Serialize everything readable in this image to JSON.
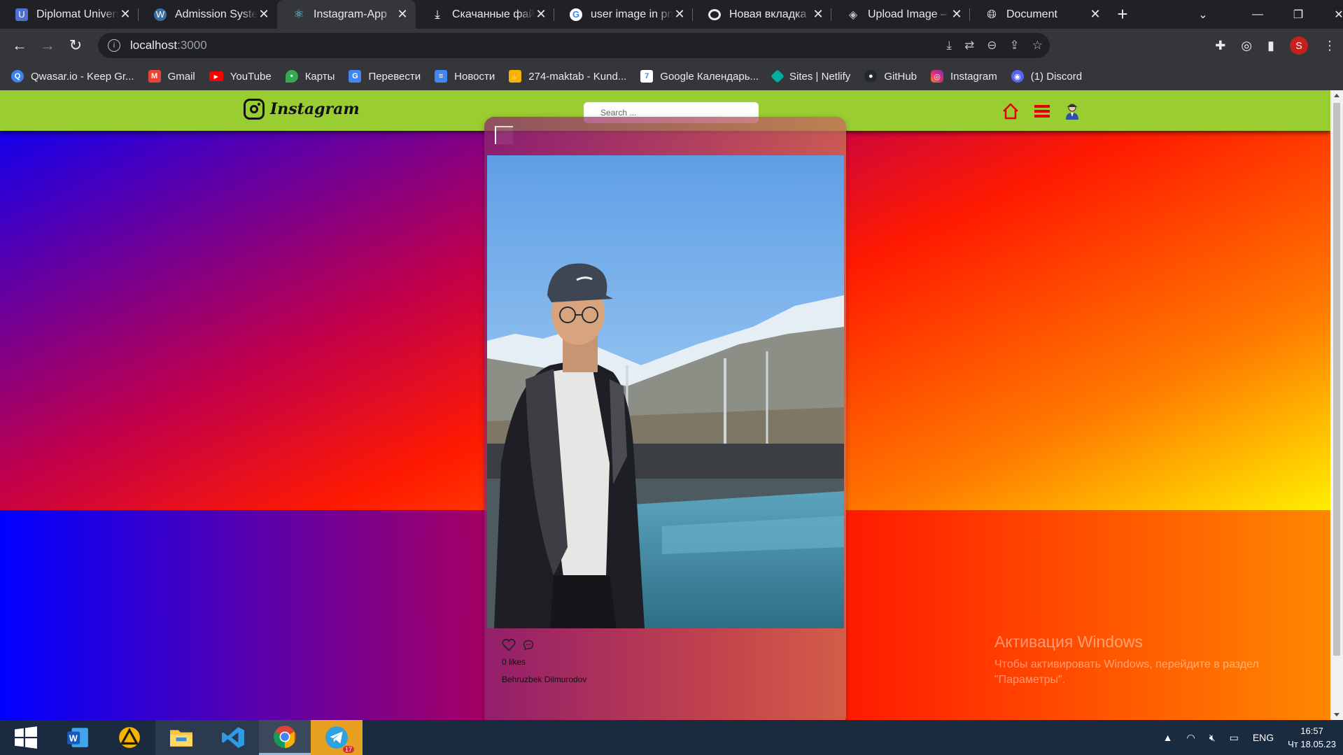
{
  "browser": {
    "tabs": [
      {
        "title": "Diplomat University",
        "favicon": "university-icon",
        "color": "#4f6fd6"
      },
      {
        "title": "Admission System",
        "favicon": "wordpress-icon",
        "color": "#3a6ea5"
      },
      {
        "title": "Instagram-App",
        "favicon": "react-icon",
        "color": "#61dafb",
        "active": true
      },
      {
        "title": "Скачанные файлы",
        "favicon": "download-icon",
        "color": "#e8eaed"
      },
      {
        "title": "user image in png",
        "favicon": "google-icon",
        "color": "#4285f4"
      },
      {
        "title": "Новая вкладка",
        "favicon": "chrome-icon",
        "color": "#e8eaed"
      },
      {
        "title": "Upload Image – n",
        "favicon": "layers-icon",
        "color": "#bdc1c6"
      },
      {
        "title": "Document",
        "favicon": "globe-icon",
        "color": "#e8eaed"
      }
    ],
    "url_host": "localhost",
    "url_port": ":3000",
    "profile_initial": "S",
    "bookmarks": [
      {
        "label": "Qwasar.io - Keep Gr...",
        "icon": "qwasar-icon",
        "color": "#3b82f6"
      },
      {
        "label": "Gmail",
        "icon": "gmail-icon",
        "color": "#ea4335"
      },
      {
        "label": "YouTube",
        "icon": "youtube-icon",
        "color": "#ff0000"
      },
      {
        "label": "Карты",
        "icon": "maps-icon",
        "color": "#34a853"
      },
      {
        "label": "Перевести",
        "icon": "translate-icon",
        "color": "#4285f4"
      },
      {
        "label": "Новости",
        "icon": "news-icon",
        "color": "#4285f4"
      },
      {
        "label": "274-maktab - Kund...",
        "icon": "hand-icon",
        "color": "#f5b400"
      },
      {
        "label": "Google Календарь...",
        "icon": "calendar-icon",
        "color": "#4285f4"
      },
      {
        "label": "Sites | Netlify",
        "icon": "netlify-icon",
        "color": "#00ad9f"
      },
      {
        "label": "GitHub",
        "icon": "github-icon",
        "color": "#24292e"
      },
      {
        "label": "Instagram",
        "icon": "instagram-icon",
        "color": "#e1306c"
      },
      {
        "label": "(1) Discord",
        "icon": "discord-icon",
        "color": "#5865f2"
      }
    ]
  },
  "app": {
    "brand": "Instagram",
    "search_placeholder": "Search ...",
    "post": {
      "likes": "0 likes",
      "author": "Behruzbek Dilmurodov"
    }
  },
  "watermark": {
    "title": "Активация Windows",
    "line1": "Чтобы активировать Windows, перейдите в раздел",
    "line2": "\"Параметры\"."
  },
  "taskbar": {
    "apps": [
      "windows-start-icon",
      "word-icon",
      "archicad-icon",
      "file-explorer-icon",
      "vscode-icon",
      "chrome-icon",
      "telegram-icon"
    ],
    "telegram_badge": "17",
    "language": "ENG",
    "time": "16:57",
    "date": "Чт 18.05.23"
  }
}
